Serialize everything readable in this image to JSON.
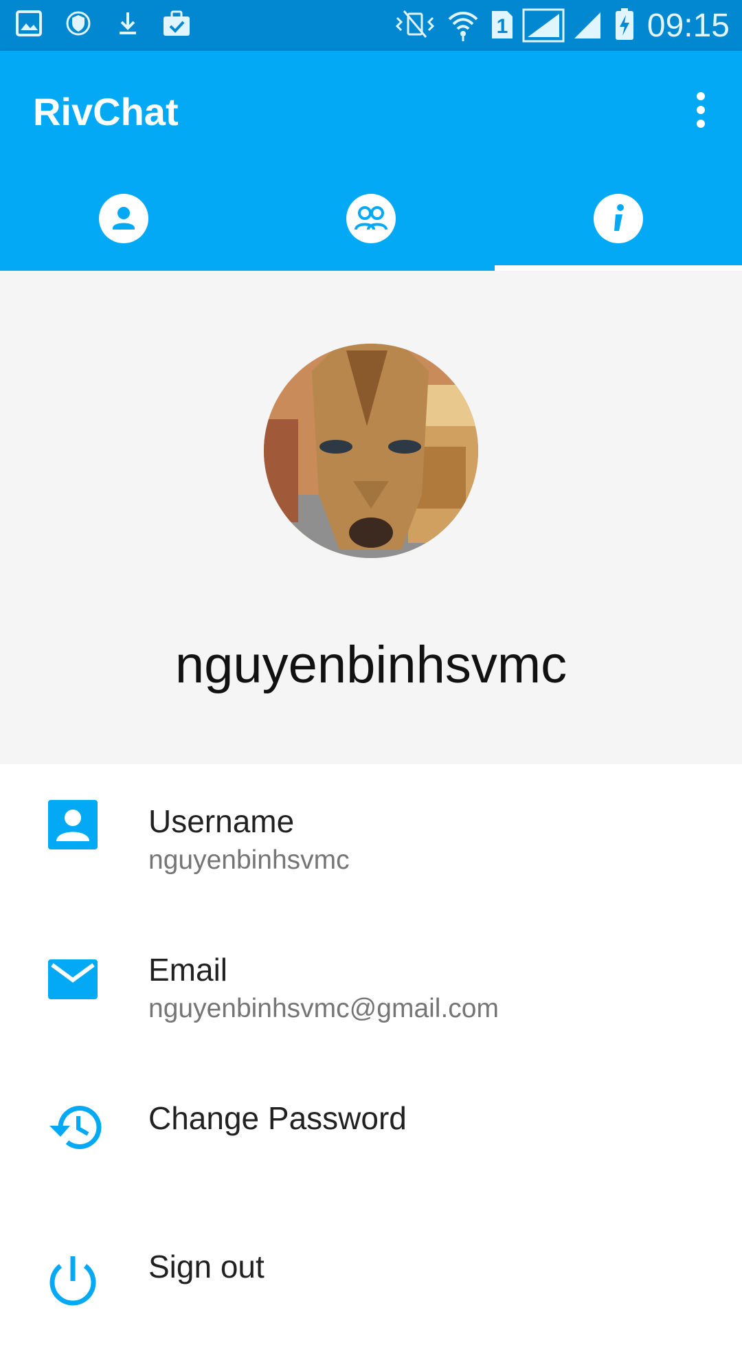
{
  "status_bar": {
    "time": "09:15",
    "sim_slot": "1",
    "icons": [
      "gallery-icon",
      "vpn-shield-icon",
      "download-icon",
      "briefcase-check-icon",
      "vibrate-icon",
      "wifi-icon",
      "sim-icon",
      "signal-icon",
      "signal-icon",
      "battery-charging-icon"
    ]
  },
  "app_bar": {
    "title": "RivChat",
    "tabs": [
      {
        "icon": "person-icon",
        "selected": false
      },
      {
        "icon": "group-icon",
        "selected": false
      },
      {
        "icon": "info-icon",
        "selected": true
      }
    ]
  },
  "profile": {
    "display_name": "nguyenbinhsvmc"
  },
  "info_items": [
    {
      "icon": "account-box-icon",
      "label": "Username",
      "value": "nguyenbinhsvmc"
    },
    {
      "icon": "email-icon",
      "label": "Email",
      "value": "nguyenbinhsvmc@gmail.com"
    },
    {
      "icon": "history-icon",
      "label": "Change Password",
      "value": ""
    },
    {
      "icon": "power-icon",
      "label": "Sign out",
      "value": ""
    }
  ],
  "colors": {
    "primary": "#03a9f4",
    "primary_dark": "#0288d1",
    "header_bg": "#f5f5f5",
    "label_text": "#212121",
    "secondary_text": "#757575"
  }
}
